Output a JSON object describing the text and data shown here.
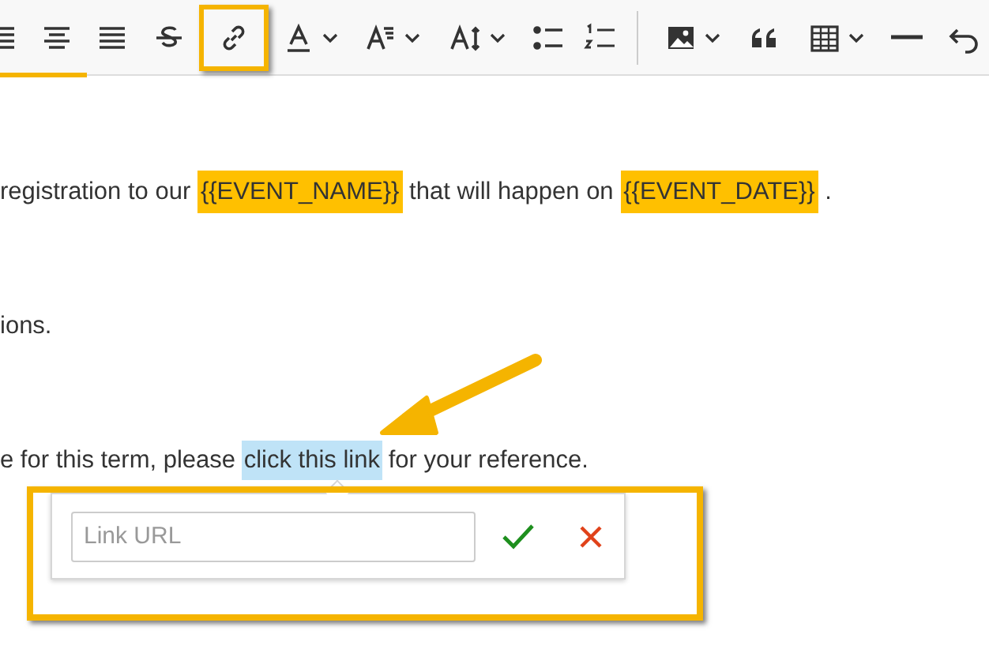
{
  "toolbar": [
    {
      "kind": "align-justify",
      "selected": false,
      "dropdown": false
    },
    {
      "kind": "align-center",
      "selected": false,
      "dropdown": false
    },
    {
      "kind": "align-justify",
      "selected": false,
      "dropdown": false
    },
    {
      "kind": "strikethrough",
      "selected": false,
      "dropdown": false
    },
    {
      "kind": "link",
      "selected": true,
      "dropdown": false
    },
    {
      "kind": "font-color",
      "selected": false,
      "dropdown": true
    },
    {
      "kind": "font-size",
      "selected": false,
      "dropdown": true
    },
    {
      "kind": "line-height",
      "selected": false,
      "dropdown": true
    },
    {
      "kind": "bullet-list",
      "selected": false,
      "dropdown": false
    },
    {
      "kind": "numbered-list",
      "selected": false,
      "dropdown": false
    },
    {
      "kind": "divider"
    },
    {
      "kind": "image",
      "selected": false,
      "dropdown": true
    },
    {
      "kind": "quote",
      "selected": false,
      "dropdown": false
    },
    {
      "kind": "table",
      "selected": false,
      "dropdown": true
    },
    {
      "kind": "horizontal-rule",
      "selected": false,
      "dropdown": false
    },
    {
      "kind": "undo",
      "selected": false,
      "dropdown": false
    }
  ],
  "paragraphs": [
    [
      {
        "kind": "text",
        "text": "registration to our"
      },
      {
        "kind": "placeholder",
        "text": "{{EVENT_NAME}}"
      },
      {
        "kind": "text",
        "text": "that will happen on"
      },
      {
        "kind": "placeholder",
        "text": "{{EVENT_DATE}}"
      },
      {
        "kind": "text",
        "text": "."
      }
    ],
    [
      {
        "kind": "text",
        "text": "ions."
      }
    ],
    [
      {
        "kind": "text",
        "text": "e for this term, please"
      },
      {
        "kind": "selection",
        "text": "click this link"
      },
      {
        "kind": "text",
        "text": "for your reference."
      }
    ]
  ],
  "link_popup": {
    "placeholder": "Link URL"
  }
}
